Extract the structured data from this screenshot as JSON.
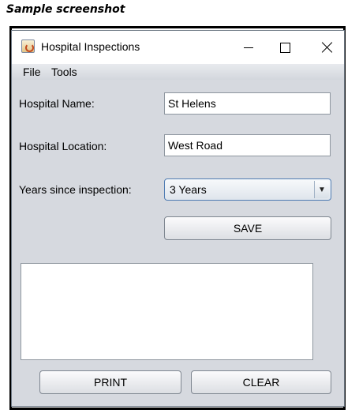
{
  "caption": "Sample screenshot",
  "window": {
    "title": "Hospital Inspections",
    "icon": "java-cup-icon"
  },
  "menubar": {
    "items": [
      "File",
      "Tools"
    ]
  },
  "form": {
    "name_label": "Hospital Name:",
    "name_value": "St Helens",
    "location_label": "Hospital Location:",
    "location_value": "West Road",
    "years_label": "Years since inspection:",
    "years_value": "3 Years",
    "save_label": "SAVE"
  },
  "output": {
    "text": ""
  },
  "footer": {
    "print_label": "PRINT",
    "clear_label": "CLEAR"
  }
}
